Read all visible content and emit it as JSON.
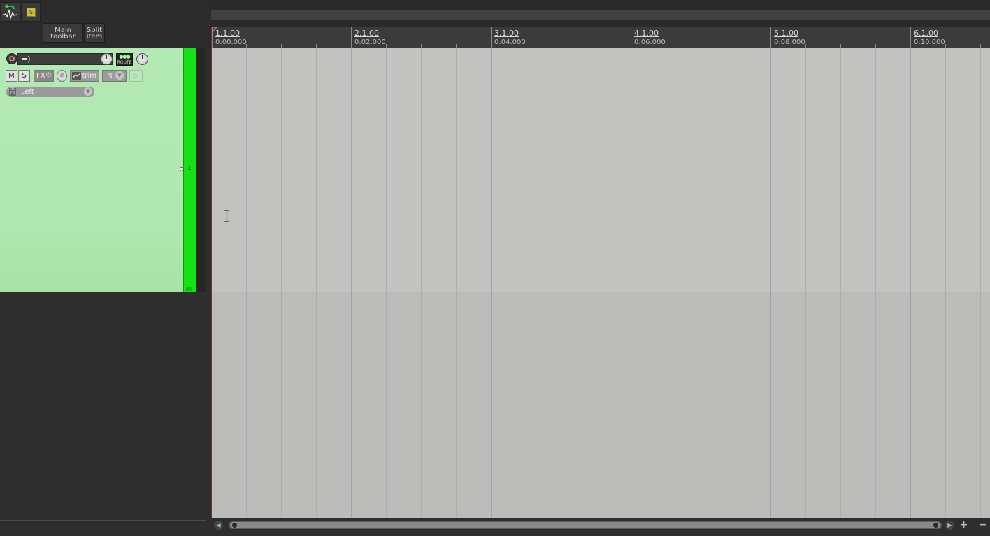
{
  "toolbar": {
    "main_toolbar_label": "Main\ntoolbar",
    "split_item_label": "Split\nitem",
    "snap_label": "S"
  },
  "ruler": {
    "marks": [
      {
        "bar": "1.1.00",
        "time": "0:00.000"
      },
      {
        "bar": "2.1.00",
        "time": "0:02.000"
      },
      {
        "bar": "3.1.00",
        "time": "0:04.000"
      },
      {
        "bar": "4.1.00",
        "time": "0:06.000"
      },
      {
        "bar": "5.1.00",
        "time": "0:08.000"
      },
      {
        "bar": "6.1.00",
        "time": "0:10.000"
      }
    ]
  },
  "track": {
    "name": "=)",
    "number": "1",
    "route_label": "ROUTE",
    "mute_label": "M",
    "solo_label": "S",
    "fx_label": "FX",
    "trim_label": "trim",
    "input_monitor_label": "IN",
    "input_label": "Left",
    "color": "#16e316"
  },
  "icons": {
    "undo": "undo-wave-icon",
    "record": "record-arm-icon",
    "phase": "phase-icon",
    "envelope": "envelope-icon"
  }
}
